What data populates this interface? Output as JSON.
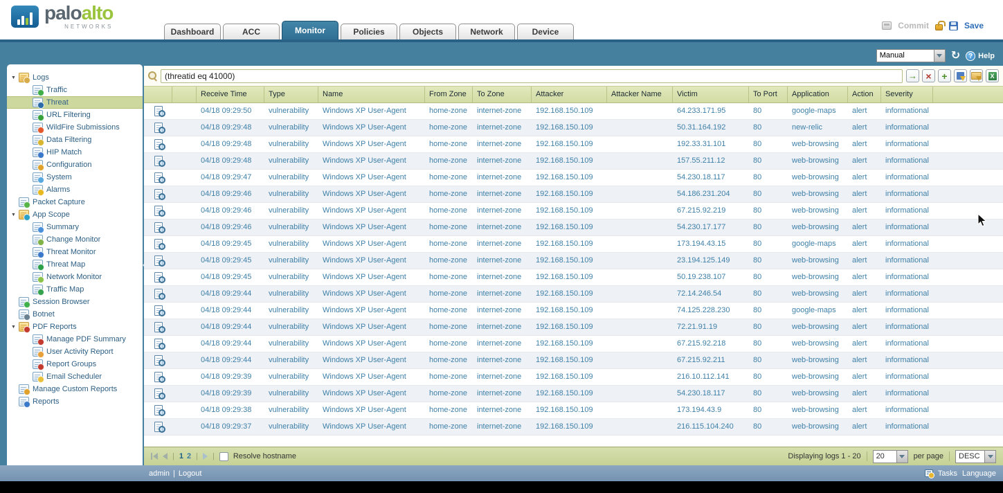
{
  "brand": {
    "name_primary": "palo",
    "name_secondary": "alto",
    "sub": "NETWORKS"
  },
  "header": {
    "tabs": [
      {
        "label": "Dashboard",
        "active": false
      },
      {
        "label": "ACC",
        "active": false
      },
      {
        "label": "Monitor",
        "active": true
      },
      {
        "label": "Policies",
        "active": false
      },
      {
        "label": "Objects",
        "active": false
      },
      {
        "label": "Network",
        "active": false
      },
      {
        "label": "Device",
        "active": false
      }
    ],
    "commit_label": "Commit",
    "save_label": "Save"
  },
  "toolbar": {
    "refresh_mode": "Manual",
    "help_label": "Help"
  },
  "filter": {
    "query": "(threatid eq 41000)",
    "buttons": [
      "apply-filter",
      "clear-filter",
      "add-filter",
      "save-filter",
      "load-filter",
      "export-csv"
    ]
  },
  "sidebar": {
    "items": [
      {
        "label": "Logs",
        "depth": 0,
        "expander": true,
        "kind": "folder",
        "icon": "logs-folder",
        "badge": "#d8ab4a"
      },
      {
        "label": "Traffic",
        "depth": 1,
        "icon": "traffic",
        "badge": "#3fae49"
      },
      {
        "label": "Threat",
        "depth": 1,
        "icon": "threat",
        "badge": "#2b6ca8",
        "selected": true
      },
      {
        "label": "URL Filtering",
        "depth": 1,
        "icon": "url-filtering",
        "badge": "#37a23c"
      },
      {
        "label": "WildFire Submissions",
        "depth": 1,
        "icon": "wildfire-submissions",
        "badge": "#e2582a"
      },
      {
        "label": "Data Filtering",
        "depth": 1,
        "icon": "data-filtering",
        "badge": "#d9b430"
      },
      {
        "label": "HIP Match",
        "depth": 1,
        "icon": "hip-match",
        "badge": "#3a78c9"
      },
      {
        "label": "Configuration",
        "depth": 1,
        "icon": "configuration",
        "badge": "#e0a22c"
      },
      {
        "label": "System",
        "depth": 1,
        "icon": "system",
        "badge": "#58a8e0"
      },
      {
        "label": "Alarms",
        "depth": 1,
        "icon": "alarms",
        "badge": "#e8b820"
      },
      {
        "label": "Packet Capture",
        "depth": 0,
        "icon": "packet-capture",
        "badge": "#58b349"
      },
      {
        "label": "App Scope",
        "depth": 0,
        "expander": true,
        "kind": "folder",
        "icon": "app-scope-folder",
        "badge": "#2da0c8"
      },
      {
        "label": "Summary",
        "depth": 1,
        "icon": "summary",
        "badge": "#4a90d9"
      },
      {
        "label": "Change Monitor",
        "depth": 1,
        "icon": "change-monitor",
        "badge": "#7fb347"
      },
      {
        "label": "Threat Monitor",
        "depth": 1,
        "icon": "threat-monitor",
        "badge": "#3a78c9"
      },
      {
        "label": "Threat Map",
        "depth": 1,
        "icon": "threat-map",
        "badge": "#2da04a"
      },
      {
        "label": "Network Monitor",
        "depth": 1,
        "icon": "network-monitor",
        "badge": "#8bc34a"
      },
      {
        "label": "Traffic Map",
        "depth": 1,
        "icon": "traffic-map",
        "badge": "#35a24e"
      },
      {
        "label": "Session Browser",
        "depth": 0,
        "icon": "session-browser",
        "badge": "#40b04a"
      },
      {
        "label": "Botnet",
        "depth": 0,
        "icon": "botnet",
        "badge": "#6a7f8f"
      },
      {
        "label": "PDF Reports",
        "depth": 0,
        "expander": true,
        "kind": "folder",
        "icon": "pdf-reports-folder",
        "badge": "#c23b2e"
      },
      {
        "label": "Manage PDF Summary",
        "depth": 1,
        "icon": "manage-pdf-summary",
        "badge": "#c23b2e"
      },
      {
        "label": "User Activity Report",
        "depth": 1,
        "icon": "user-activity-report",
        "badge": "#e8a03c"
      },
      {
        "label": "Report Groups",
        "depth": 1,
        "icon": "report-groups",
        "badge": "#c23b2e"
      },
      {
        "label": "Email Scheduler",
        "depth": 1,
        "icon": "email-scheduler",
        "badge": "#e8c23c"
      },
      {
        "label": "Manage Custom Reports",
        "depth": 0,
        "icon": "manage-custom-reports",
        "badge": "#e0a22c"
      },
      {
        "label": "Reports",
        "depth": 0,
        "icon": "reports",
        "badge": "#3a78c9"
      }
    ]
  },
  "table": {
    "columns": [
      "",
      "",
      "Receive Time",
      "Type",
      "Name",
      "From Zone",
      "To Zone",
      "Attacker",
      "Attacker Name",
      "Victim",
      "To Port",
      "Application",
      "Action",
      "Severity",
      ""
    ],
    "rows": [
      {
        "receive_time": "04/18 09:29:50",
        "type": "vulnerability",
        "name": "Windows XP User-Agent",
        "from_zone": "home-zone",
        "to_zone": "internet-zone",
        "attacker": "192.168.150.109",
        "attacker_name": "",
        "victim": "64.233.171.95",
        "to_port": "80",
        "application": "google-maps",
        "action": "alert",
        "severity": "informational"
      },
      {
        "receive_time": "04/18 09:29:48",
        "type": "vulnerability",
        "name": "Windows XP User-Agent",
        "from_zone": "home-zone",
        "to_zone": "internet-zone",
        "attacker": "192.168.150.109",
        "attacker_name": "",
        "victim": "50.31.164.192",
        "to_port": "80",
        "application": "new-relic",
        "action": "alert",
        "severity": "informational"
      },
      {
        "receive_time": "04/18 09:29:48",
        "type": "vulnerability",
        "name": "Windows XP User-Agent",
        "from_zone": "home-zone",
        "to_zone": "internet-zone",
        "attacker": "192.168.150.109",
        "attacker_name": "",
        "victim": "192.33.31.101",
        "to_port": "80",
        "application": "web-browsing",
        "action": "alert",
        "severity": "informational"
      },
      {
        "receive_time": "04/18 09:29:48",
        "type": "vulnerability",
        "name": "Windows XP User-Agent",
        "from_zone": "home-zone",
        "to_zone": "internet-zone",
        "attacker": "192.168.150.109",
        "attacker_name": "",
        "victim": "157.55.211.12",
        "to_port": "80",
        "application": "web-browsing",
        "action": "alert",
        "severity": "informational"
      },
      {
        "receive_time": "04/18 09:29:47",
        "type": "vulnerability",
        "name": "Windows XP User-Agent",
        "from_zone": "home-zone",
        "to_zone": "internet-zone",
        "attacker": "192.168.150.109",
        "attacker_name": "",
        "victim": "54.230.18.117",
        "to_port": "80",
        "application": "web-browsing",
        "action": "alert",
        "severity": "informational"
      },
      {
        "receive_time": "04/18 09:29:46",
        "type": "vulnerability",
        "name": "Windows XP User-Agent",
        "from_zone": "home-zone",
        "to_zone": "internet-zone",
        "attacker": "192.168.150.109",
        "attacker_name": "",
        "victim": "54.186.231.204",
        "to_port": "80",
        "application": "web-browsing",
        "action": "alert",
        "severity": "informational"
      },
      {
        "receive_time": "04/18 09:29:46",
        "type": "vulnerability",
        "name": "Windows XP User-Agent",
        "from_zone": "home-zone",
        "to_zone": "internet-zone",
        "attacker": "192.168.150.109",
        "attacker_name": "",
        "victim": "67.215.92.219",
        "to_port": "80",
        "application": "web-browsing",
        "action": "alert",
        "severity": "informational"
      },
      {
        "receive_time": "04/18 09:29:46",
        "type": "vulnerability",
        "name": "Windows XP User-Agent",
        "from_zone": "home-zone",
        "to_zone": "internet-zone",
        "attacker": "192.168.150.109",
        "attacker_name": "",
        "victim": "54.230.17.177",
        "to_port": "80",
        "application": "web-browsing",
        "action": "alert",
        "severity": "informational"
      },
      {
        "receive_time": "04/18 09:29:45",
        "type": "vulnerability",
        "name": "Windows XP User-Agent",
        "from_zone": "home-zone",
        "to_zone": "internet-zone",
        "attacker": "192.168.150.109",
        "attacker_name": "",
        "victim": "173.194.43.15",
        "to_port": "80",
        "application": "google-maps",
        "action": "alert",
        "severity": "informational"
      },
      {
        "receive_time": "04/18 09:29:45",
        "type": "vulnerability",
        "name": "Windows XP User-Agent",
        "from_zone": "home-zone",
        "to_zone": "internet-zone",
        "attacker": "192.168.150.109",
        "attacker_name": "",
        "victim": "23.194.125.149",
        "to_port": "80",
        "application": "web-browsing",
        "action": "alert",
        "severity": "informational"
      },
      {
        "receive_time": "04/18 09:29:45",
        "type": "vulnerability",
        "name": "Windows XP User-Agent",
        "from_zone": "home-zone",
        "to_zone": "internet-zone",
        "attacker": "192.168.150.109",
        "attacker_name": "",
        "victim": "50.19.238.107",
        "to_port": "80",
        "application": "web-browsing",
        "action": "alert",
        "severity": "informational"
      },
      {
        "receive_time": "04/18 09:29:44",
        "type": "vulnerability",
        "name": "Windows XP User-Agent",
        "from_zone": "home-zone",
        "to_zone": "internet-zone",
        "attacker": "192.168.150.109",
        "attacker_name": "",
        "victim": "72.14.246.54",
        "to_port": "80",
        "application": "web-browsing",
        "action": "alert",
        "severity": "informational"
      },
      {
        "receive_time": "04/18 09:29:44",
        "type": "vulnerability",
        "name": "Windows XP User-Agent",
        "from_zone": "home-zone",
        "to_zone": "internet-zone",
        "attacker": "192.168.150.109",
        "attacker_name": "",
        "victim": "74.125.228.230",
        "to_port": "80",
        "application": "google-maps",
        "action": "alert",
        "severity": "informational"
      },
      {
        "receive_time": "04/18 09:29:44",
        "type": "vulnerability",
        "name": "Windows XP User-Agent",
        "from_zone": "home-zone",
        "to_zone": "internet-zone",
        "attacker": "192.168.150.109",
        "attacker_name": "",
        "victim": "72.21.91.19",
        "to_port": "80",
        "application": "web-browsing",
        "action": "alert",
        "severity": "informational"
      },
      {
        "receive_time": "04/18 09:29:44",
        "type": "vulnerability",
        "name": "Windows XP User-Agent",
        "from_zone": "home-zone",
        "to_zone": "internet-zone",
        "attacker": "192.168.150.109",
        "attacker_name": "",
        "victim": "67.215.92.218",
        "to_port": "80",
        "application": "web-browsing",
        "action": "alert",
        "severity": "informational"
      },
      {
        "receive_time": "04/18 09:29:44",
        "type": "vulnerability",
        "name": "Windows XP User-Agent",
        "from_zone": "home-zone",
        "to_zone": "internet-zone",
        "attacker": "192.168.150.109",
        "attacker_name": "",
        "victim": "67.215.92.211",
        "to_port": "80",
        "application": "web-browsing",
        "action": "alert",
        "severity": "informational"
      },
      {
        "receive_time": "04/18 09:29:39",
        "type": "vulnerability",
        "name": "Windows XP User-Agent",
        "from_zone": "home-zone",
        "to_zone": "internet-zone",
        "attacker": "192.168.150.109",
        "attacker_name": "",
        "victim": "216.10.112.141",
        "to_port": "80",
        "application": "web-browsing",
        "action": "alert",
        "severity": "informational"
      },
      {
        "receive_time": "04/18 09:29:39",
        "type": "vulnerability",
        "name": "Windows XP User-Agent",
        "from_zone": "home-zone",
        "to_zone": "internet-zone",
        "attacker": "192.168.150.109",
        "attacker_name": "",
        "victim": "54.230.18.117",
        "to_port": "80",
        "application": "web-browsing",
        "action": "alert",
        "severity": "informational"
      },
      {
        "receive_time": "04/18 09:29:38",
        "type": "vulnerability",
        "name": "Windows XP User-Agent",
        "from_zone": "home-zone",
        "to_zone": "internet-zone",
        "attacker": "192.168.150.109",
        "attacker_name": "",
        "victim": "173.194.43.9",
        "to_port": "80",
        "application": "web-browsing",
        "action": "alert",
        "severity": "informational"
      },
      {
        "receive_time": "04/18 09:29:37",
        "type": "vulnerability",
        "name": "Windows XP User-Agent",
        "from_zone": "home-zone",
        "to_zone": "internet-zone",
        "attacker": "192.168.150.109",
        "attacker_name": "",
        "victim": "216.115.104.240",
        "to_port": "80",
        "application": "web-browsing",
        "action": "alert",
        "severity": "informational"
      }
    ]
  },
  "pagination": {
    "pages": [
      "1",
      "2"
    ],
    "current_page": "1",
    "resolve_hostname_label": "Resolve hostname",
    "displaying": "Displaying logs 1 - 20",
    "per_page_value": "20",
    "per_page_label": "per page",
    "sort_order": "DESC"
  },
  "footer": {
    "user": "admin",
    "separator": "|",
    "logout_label": "Logout",
    "tasks_label": "Tasks",
    "language_label": "Language"
  },
  "colors": {
    "band-teal": "#45809f",
    "tab-active": "#34708f",
    "brand-green": "#9ac43d",
    "brand-gray": "#5b6770",
    "table-header-olive": "#d9e0ad",
    "selected-olive": "#cdd89f",
    "pagebar-olive": "#ccd7a0",
    "row-link-blue": "#3f80a9",
    "footer-slate": "#7f9cb8",
    "save-blue": "#2e6db8",
    "help-blue": "#3a8fd0"
  }
}
